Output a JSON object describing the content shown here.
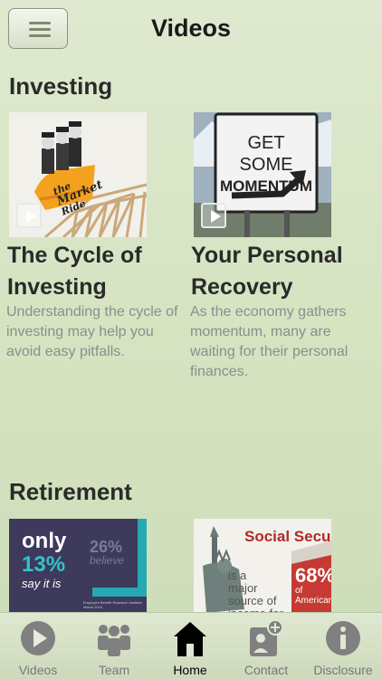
{
  "header": {
    "title": "Videos"
  },
  "sections": [
    {
      "title": "Investing",
      "cards": [
        {
          "thumb_text": [
            "the",
            "Market",
            "Ride"
          ],
          "title_line1": "The Cycle of",
          "title_line2": "Investing",
          "desc": [
            "Understanding the cycle of",
            "investing may help you",
            "avoid easy pitfalls."
          ]
        },
        {
          "thumb_text": [
            "GET SOME",
            "MOMENTUM"
          ],
          "title_line1": "Your Personal",
          "title_line2": "Recovery",
          "desc": [
            "As the economy gathers",
            "momentum, many are",
            "waiting for their personal",
            "finances."
          ]
        }
      ]
    },
    {
      "title": "Retirement",
      "cards": [
        {
          "thumb_text": [
            "only",
            "13%",
            "say it is",
            "26%",
            "believe",
            "Employee Benefit Research Institute, March 2015"
          ]
        },
        {
          "thumb_text": [
            "Social Security",
            "is a",
            "major",
            "source of",
            "income for",
            "68%",
            "of",
            "Americans"
          ]
        }
      ]
    }
  ],
  "tabs": [
    {
      "label": "Videos",
      "icon": "play-circle-icon"
    },
    {
      "label": "Team",
      "icon": "team-icon"
    },
    {
      "label": "Home",
      "icon": "home-icon",
      "active": true
    },
    {
      "label": "Contact",
      "icon": "contact-icon"
    },
    {
      "label": "Disclosure",
      "icon": "info-icon"
    }
  ],
  "colors": {
    "accent": "#1a1a1a",
    "muted_text": "#8d8d8d",
    "background": "#d6e4c2"
  }
}
